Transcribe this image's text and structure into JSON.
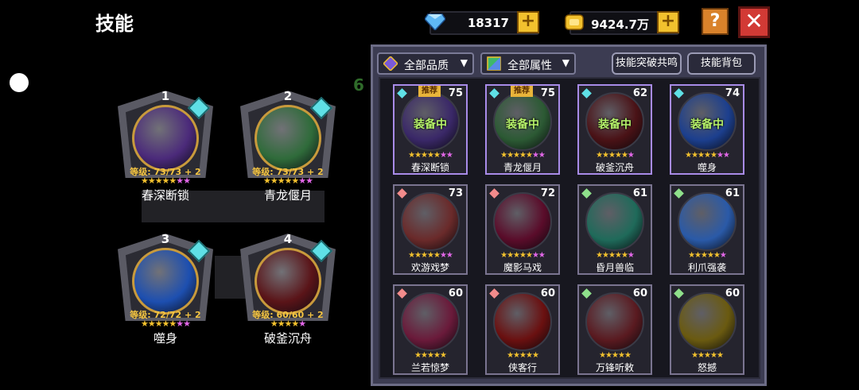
{
  "header": {
    "title": "技能",
    "gems": "18317",
    "gold": "9424.7万",
    "help_label": "?",
    "close_label": "✕",
    "plus_label": "+"
  },
  "background_hint": "6",
  "equipped": [
    {
      "slot": "1",
      "level": "等级: 73/73 + 2",
      "name": "春深断锁",
      "stars": "★★★★★",
      "extra_stars": "★★",
      "orb_color": "#4b2a7a"
    },
    {
      "slot": "2",
      "level": "等级: 73/73 + 2",
      "name": "青龙偃月",
      "stars": "★★★★★",
      "extra_stars": "★★",
      "orb_color": "#2f6b3a"
    },
    {
      "slot": "3",
      "level": "等级: 72/72 + 2",
      "name": "噬身",
      "stars": "★★★★★",
      "extra_stars": "★★",
      "orb_color": "#1d4fb0"
    },
    {
      "slot": "4",
      "level": "等级: 60/60 + 2",
      "name": "破釜沉舟",
      "stars": "★★★★",
      "extra_stars": "★",
      "orb_color": "#5a1418"
    }
  ],
  "filters": {
    "quality": "全部品质",
    "attribute": "全部属性",
    "resonance": "技能突破共鸣",
    "bag": "技能背包"
  },
  "cards": [
    {
      "name": "春深断锁",
      "level": "75",
      "badge": "推荐",
      "equipped": "装备中",
      "stars": "★★★★★",
      "extra_stars": "★★",
      "diamond": "#5fe0e6",
      "orb_color": "#3a2868"
    },
    {
      "name": "青龙偃月",
      "level": "75",
      "badge": "推荐",
      "equipped": "装备中",
      "stars": "★★★★★",
      "extra_stars": "★★",
      "diamond": "#5fe0e6",
      "orb_color": "#2c5a34"
    },
    {
      "name": "破釜沉舟",
      "level": "62",
      "badge": "",
      "equipped": "装备中",
      "stars": "★★★★★",
      "extra_stars": "★",
      "diamond": "#5fe0e6",
      "orb_color": "#4a1216"
    },
    {
      "name": "噬身",
      "level": "74",
      "badge": "",
      "equipped": "装备中",
      "stars": "★★★★★",
      "extra_stars": "★★",
      "diamond": "#5fe0e6",
      "orb_color": "#1c3f8e"
    },
    {
      "name": "欢游戏梦",
      "level": "73",
      "badge": "",
      "equipped": "",
      "stars": "★★★★★",
      "extra_stars": "★★",
      "diamond": "#f28b8b",
      "orb_color": "#6a2a2a"
    },
    {
      "name": "魔影马戏",
      "level": "72",
      "badge": "",
      "equipped": "",
      "stars": "★★★★★",
      "extra_stars": "★★",
      "diamond": "#f28b8b",
      "orb_color": "#5a0c2a"
    },
    {
      "name": "昏月兽临",
      "level": "61",
      "badge": "",
      "equipped": "",
      "stars": "★★★★★",
      "extra_stars": "★",
      "diamond": "#8fe08b",
      "orb_color": "#1f6a5a"
    },
    {
      "name": "利爪强袭",
      "level": "61",
      "badge": "",
      "equipped": "",
      "stars": "★★★★★",
      "extra_stars": "★",
      "diamond": "#8fe08b",
      "orb_color": "#2a5aa8"
    },
    {
      "name": "兰若惊梦",
      "level": "60",
      "badge": "",
      "equipped": "",
      "stars": "★★★★★",
      "extra_stars": "",
      "diamond": "#f28b8b",
      "orb_color": "#6a1a3a"
    },
    {
      "name": "侠客行",
      "level": "60",
      "badge": "",
      "equipped": "",
      "stars": "★★★★★",
      "extra_stars": "",
      "diamond": "#f28b8b",
      "orb_color": "#6a1010"
    },
    {
      "name": "万锋听敕",
      "level": "60",
      "badge": "",
      "equipped": "",
      "stars": "★★★★★",
      "extra_stars": "",
      "diamond": "#8fe08b",
      "orb_color": "#5a1a20"
    },
    {
      "name": "怒撼",
      "level": "60",
      "badge": "",
      "equipped": "",
      "stars": "★★★★★",
      "extra_stars": "",
      "diamond": "#8fe08b",
      "orb_color": "#6a5a10"
    }
  ]
}
